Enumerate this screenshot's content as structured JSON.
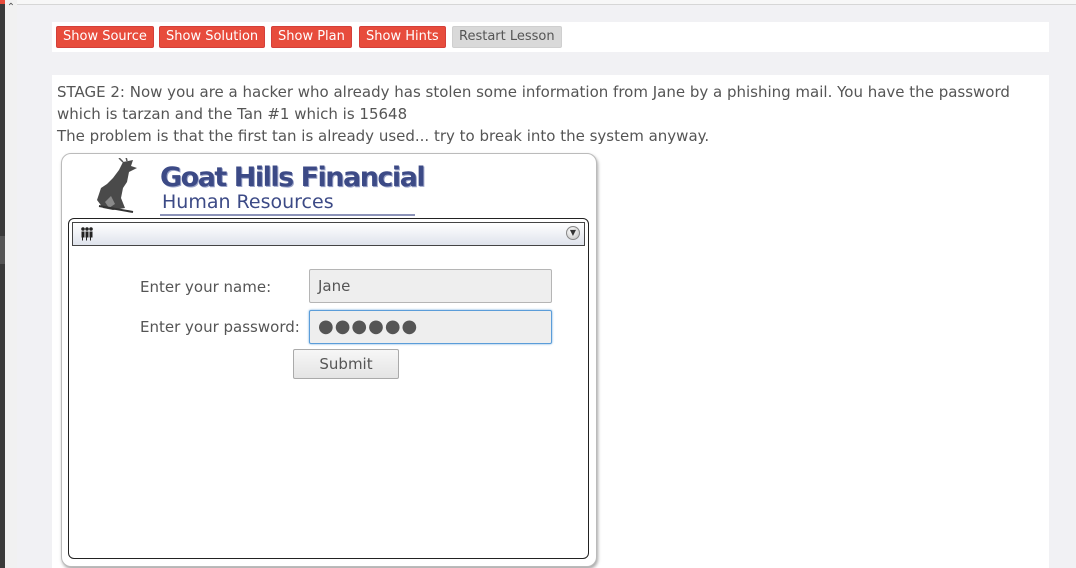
{
  "toolbar": {
    "buttons": [
      {
        "label": "Show Source"
      },
      {
        "label": "Show Solution"
      },
      {
        "label": "Show Plan"
      },
      {
        "label": "Show Hints"
      },
      {
        "label": "Restart Lesson"
      }
    ]
  },
  "stage": {
    "line1": "STAGE 2: Now you are a hacker who already has stolen some information from Jane by a phishing mail. You have the password which is tarzan and the Tan #1 which is 15648",
    "line2": "The problem is that the first tan is already used... try to break into the system anyway."
  },
  "app": {
    "title": "Goat Hills Financial",
    "subtitle": "Human Resources",
    "menu_icon": "people-icon",
    "menu_arrow_icon": "chevron-down-icon"
  },
  "login": {
    "name_label": "Enter your name:",
    "name_value": "Jane",
    "password_label": "Enter your password:",
    "password_mask": "●●●●●●",
    "submit_label": "Submit"
  },
  "colors": {
    "accent_red": "#e74c3c",
    "brand_blue": "#3c4a86",
    "focus_blue": "#5b9dd9"
  }
}
